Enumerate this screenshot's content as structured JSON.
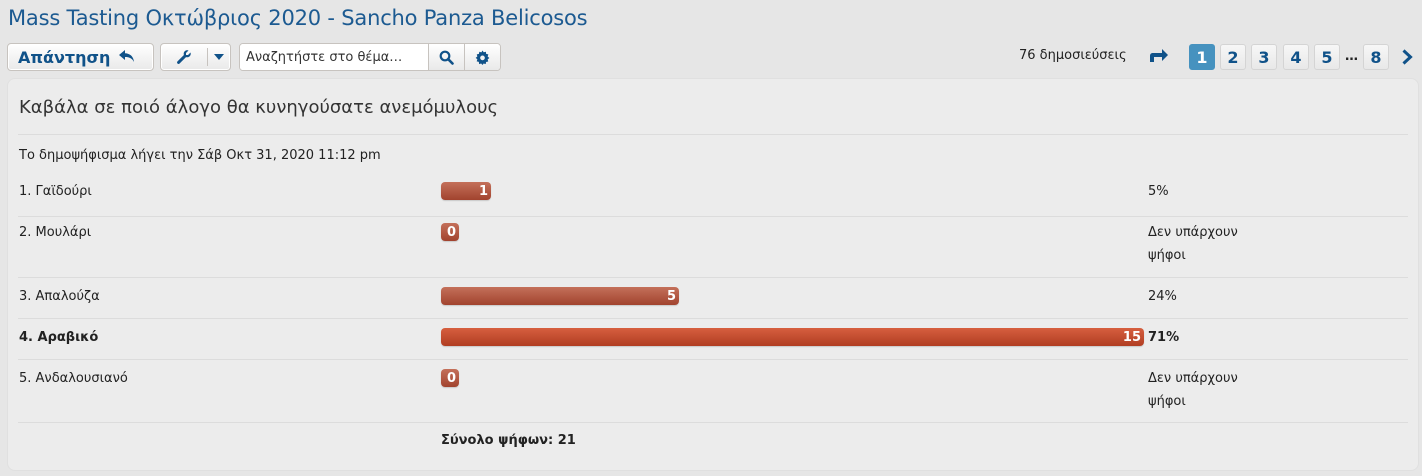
{
  "topic": {
    "title": "Mass Tasting Οκτώβριος 2020 - Sancho Panza Belicosos"
  },
  "toolbar": {
    "reply_label": "Απάντηση",
    "search_placeholder": "Αναζητήστε στο θέμα…"
  },
  "pagination": {
    "post_count": "76 δημοσιεύσεις",
    "pages": [
      "1",
      "2",
      "3",
      "4",
      "5",
      "8"
    ],
    "active_page": "1",
    "ellipsis": "…"
  },
  "poll": {
    "question": "Καβάλα σε ποιό άλογο θα κυνηγούσατε ανεμόμυλους",
    "end_text": "Το δημοψήφισμα λήγει την Σάβ Οκτ 31, 2020 11:12 pm",
    "options": [
      {
        "label": "1. Γαϊδούρι",
        "votes": "1",
        "percent": "5%",
        "share": 0.05,
        "winner": false
      },
      {
        "label": "2. Μουλάρι",
        "votes": "0",
        "percent": "Δεν υπάρχουν ψήφοι",
        "share": 0,
        "winner": false
      },
      {
        "label": "3. Απαλούζα",
        "votes": "5",
        "percent": "24%",
        "share": 0.24,
        "winner": false
      },
      {
        "label": "4. Αραβικό",
        "votes": "15",
        "percent": "71%",
        "share": 0.71,
        "winner": true
      },
      {
        "label": "5. Ανδαλουσιανό",
        "votes": "0",
        "percent": "Δεν υπάρχουν ψήφοι",
        "share": 0,
        "winner": false
      }
    ],
    "total": "Σύνολο ψήφων: 21"
  },
  "colors": {
    "link_blue": "#105289",
    "bar": "#a1432e",
    "bar_winner": "#b13d22",
    "active_page": "#4692bf"
  }
}
